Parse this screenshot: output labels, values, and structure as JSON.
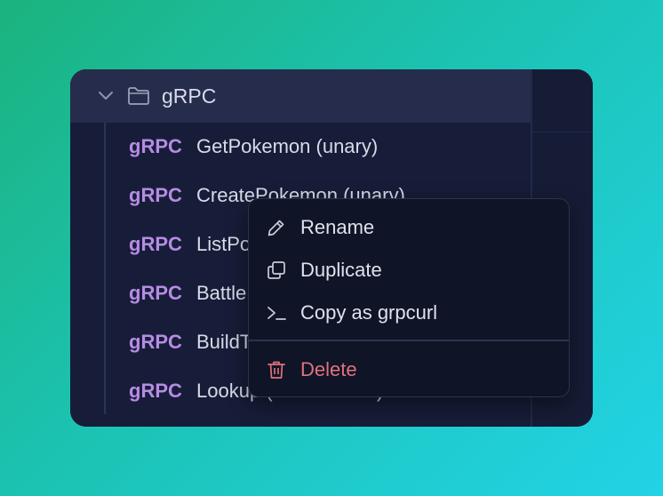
{
  "folder": {
    "label": "gRPC"
  },
  "requests": [
    {
      "method": "gRPC",
      "name": "GetPokemon (unary)"
    },
    {
      "method": "gRPC",
      "name": "CreatePokemon (unary)"
    },
    {
      "method": "gRPC",
      "name": "ListPokemon (server streaming)"
    },
    {
      "method": "gRPC",
      "name": "Battle (bidirectional)"
    },
    {
      "method": "gRPC",
      "name": "BuildTeam (client streaming)"
    },
    {
      "method": "gRPC",
      "name": "Lookup (bidirectional)"
    }
  ],
  "context_menu": {
    "items": [
      {
        "label": "Rename",
        "icon": "pencil-icon"
      },
      {
        "label": "Duplicate",
        "icon": "copy-icon"
      },
      {
        "label": "Copy as grpcurl",
        "icon": "terminal-icon"
      },
      {
        "label": "Delete",
        "icon": "trash-icon",
        "color": "#e0727e"
      }
    ]
  },
  "colors": {
    "method": "#b58be4",
    "danger": "#e0727e",
    "accent_bg": "#262c4c"
  }
}
